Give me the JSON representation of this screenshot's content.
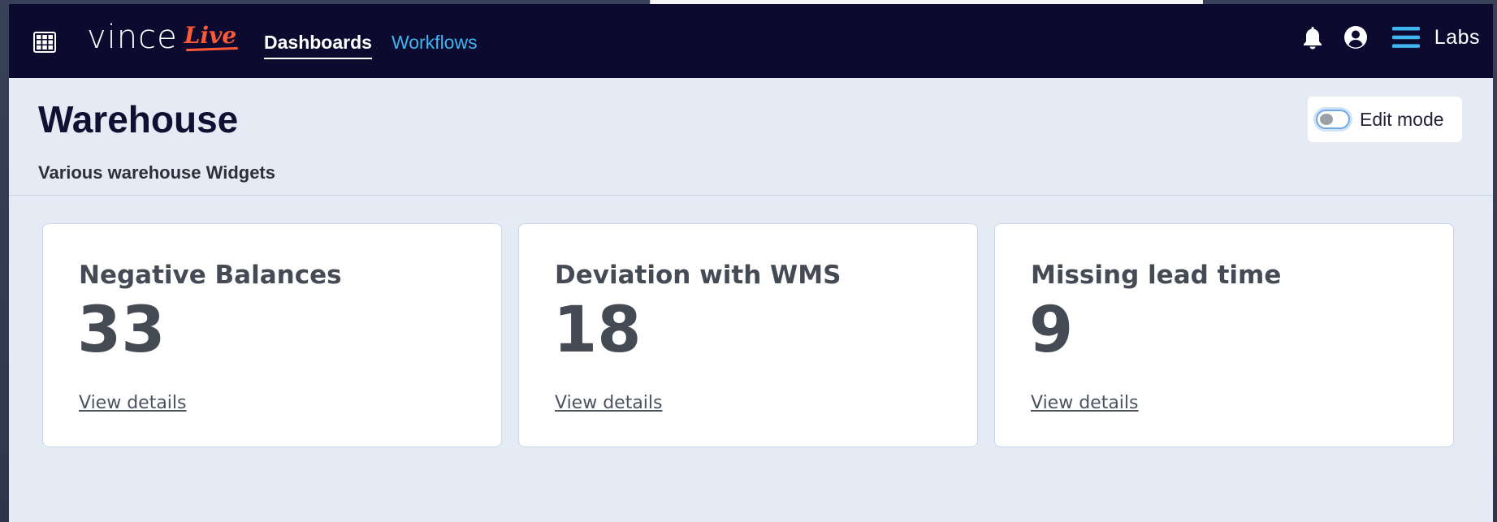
{
  "app": {
    "logo_text": "vince",
    "logo_accent": "Live"
  },
  "nav": {
    "links": [
      {
        "label": "Dashboards",
        "active": true
      },
      {
        "label": "Workflows",
        "active": false
      }
    ],
    "labs_label": "Labs"
  },
  "icons": {
    "apps_grid": "apps-grid-icon",
    "bell": "bell-icon",
    "user": "user-circle-icon",
    "menu": "hamburger-menu-icon"
  },
  "header": {
    "title": "Warehouse",
    "subtitle": "Various warehouse Widgets",
    "edit_mode_label": "Edit mode",
    "edit_mode_on": false
  },
  "widgets": [
    {
      "title": "Negative Balances",
      "value": "33",
      "link": "View details"
    },
    {
      "title": "Deviation with WMS",
      "value": "18",
      "link": "View details"
    },
    {
      "title": "Missing lead time",
      "value": "9",
      "link": "View details"
    }
  ],
  "colors": {
    "navbar_bg": "#0c0a2e",
    "page_bg": "#e4ebf5",
    "link_inactive": "#3fb6f0",
    "logo_accent": "#ff5a36",
    "widget_text": "#454b55"
  }
}
